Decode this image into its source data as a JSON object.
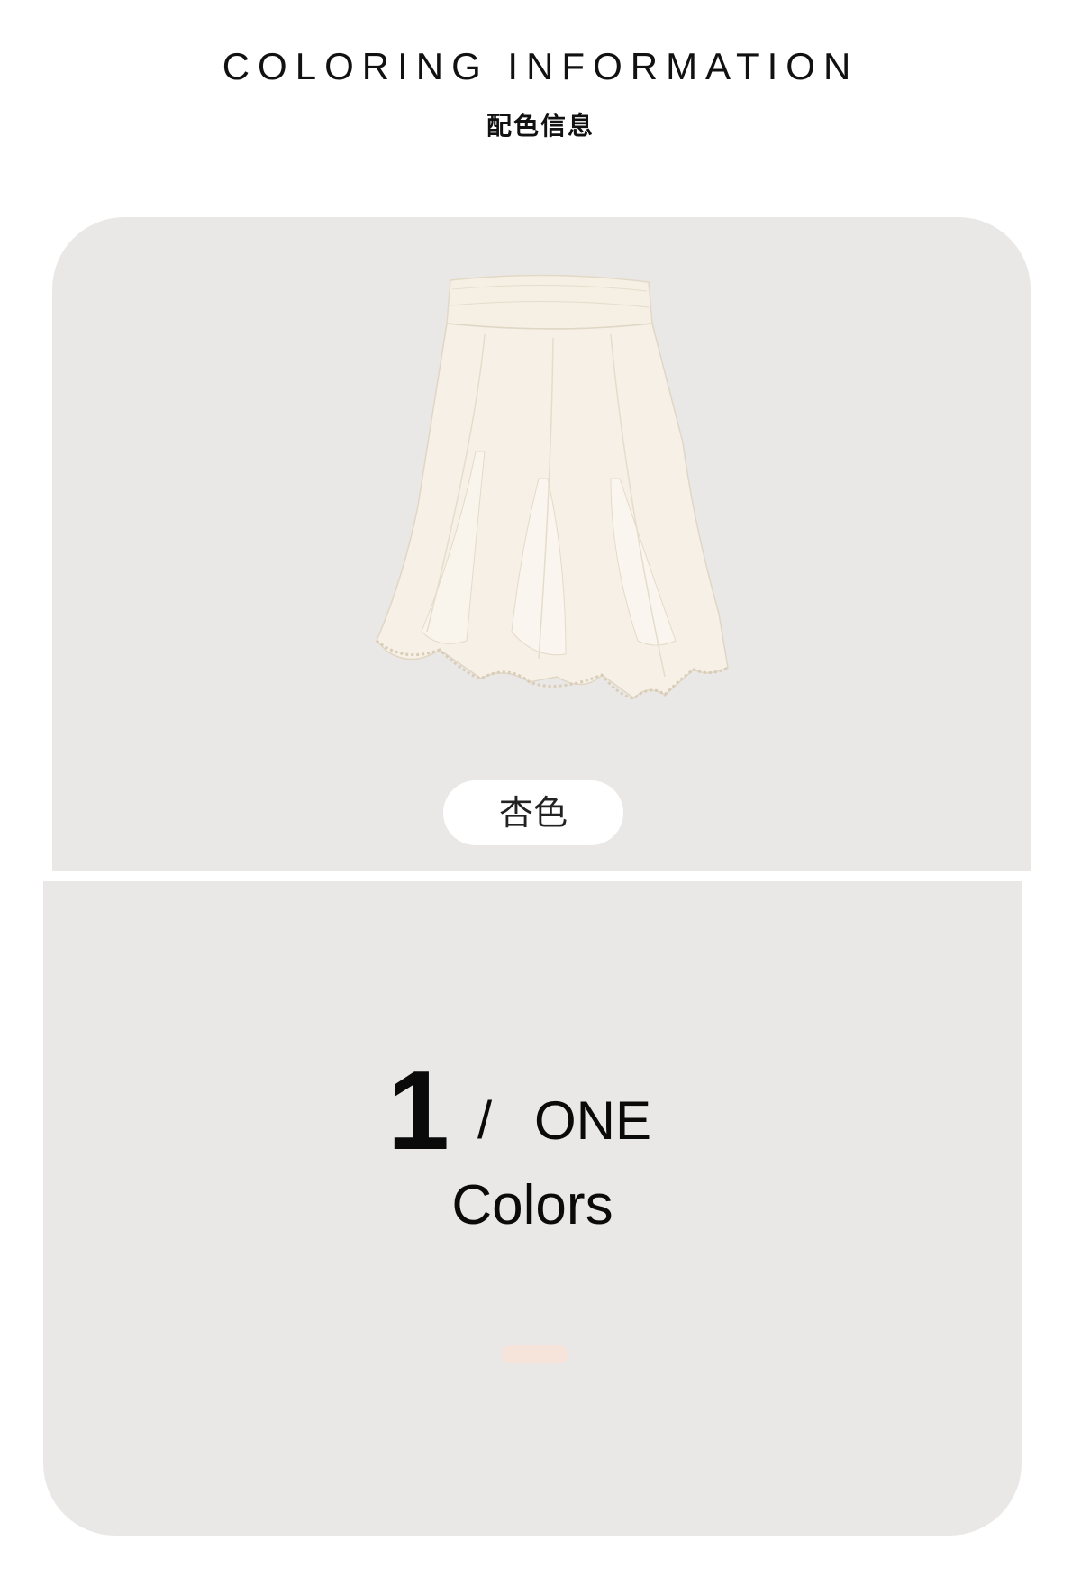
{
  "header": {
    "title_en": "COLORING INFORMATION",
    "title_zh": "配色信息"
  },
  "product": {
    "image_icon": "skirt-icon",
    "color_name": "杏色",
    "color_hex": "#f3ebdc"
  },
  "summary": {
    "count": "1",
    "separator": "/",
    "count_word": "ONE",
    "label": "Colors",
    "swatches": [
      "#f6e3da"
    ]
  },
  "colors": {
    "card_background": "#eae8e7",
    "text": "#0a0a0a"
  }
}
